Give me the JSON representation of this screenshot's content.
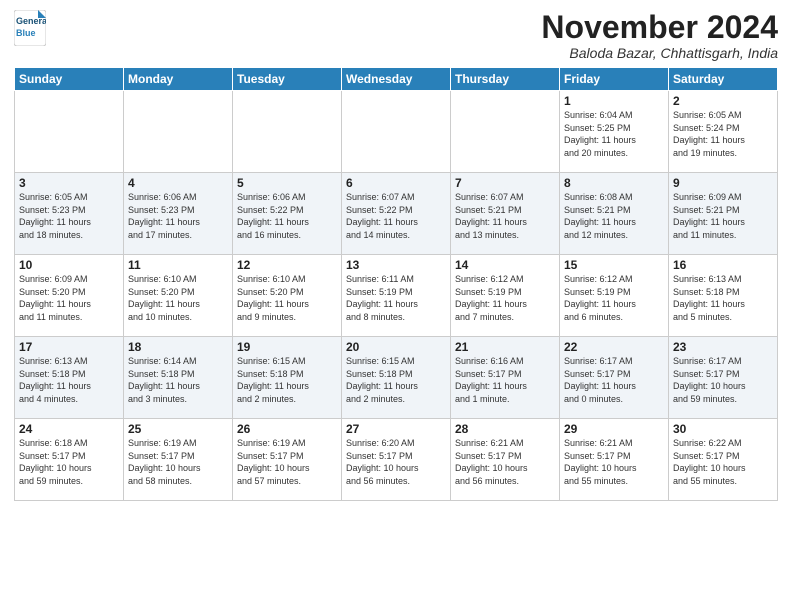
{
  "header": {
    "logo_line1": "General",
    "logo_line2": "Blue",
    "month": "November 2024",
    "location": "Baloda Bazar, Chhattisgarh, India"
  },
  "days_of_week": [
    "Sunday",
    "Monday",
    "Tuesday",
    "Wednesday",
    "Thursday",
    "Friday",
    "Saturday"
  ],
  "weeks": [
    [
      {
        "day": "",
        "info": ""
      },
      {
        "day": "",
        "info": ""
      },
      {
        "day": "",
        "info": ""
      },
      {
        "day": "",
        "info": ""
      },
      {
        "day": "",
        "info": ""
      },
      {
        "day": "1",
        "info": "Sunrise: 6:04 AM\nSunset: 5:25 PM\nDaylight: 11 hours\nand 20 minutes."
      },
      {
        "day": "2",
        "info": "Sunrise: 6:05 AM\nSunset: 5:24 PM\nDaylight: 11 hours\nand 19 minutes."
      }
    ],
    [
      {
        "day": "3",
        "info": "Sunrise: 6:05 AM\nSunset: 5:23 PM\nDaylight: 11 hours\nand 18 minutes."
      },
      {
        "day": "4",
        "info": "Sunrise: 6:06 AM\nSunset: 5:23 PM\nDaylight: 11 hours\nand 17 minutes."
      },
      {
        "day": "5",
        "info": "Sunrise: 6:06 AM\nSunset: 5:22 PM\nDaylight: 11 hours\nand 16 minutes."
      },
      {
        "day": "6",
        "info": "Sunrise: 6:07 AM\nSunset: 5:22 PM\nDaylight: 11 hours\nand 14 minutes."
      },
      {
        "day": "7",
        "info": "Sunrise: 6:07 AM\nSunset: 5:21 PM\nDaylight: 11 hours\nand 13 minutes."
      },
      {
        "day": "8",
        "info": "Sunrise: 6:08 AM\nSunset: 5:21 PM\nDaylight: 11 hours\nand 12 minutes."
      },
      {
        "day": "9",
        "info": "Sunrise: 6:09 AM\nSunset: 5:21 PM\nDaylight: 11 hours\nand 11 minutes."
      }
    ],
    [
      {
        "day": "10",
        "info": "Sunrise: 6:09 AM\nSunset: 5:20 PM\nDaylight: 11 hours\nand 11 minutes."
      },
      {
        "day": "11",
        "info": "Sunrise: 6:10 AM\nSunset: 5:20 PM\nDaylight: 11 hours\nand 10 minutes."
      },
      {
        "day": "12",
        "info": "Sunrise: 6:10 AM\nSunset: 5:20 PM\nDaylight: 11 hours\nand 9 minutes."
      },
      {
        "day": "13",
        "info": "Sunrise: 6:11 AM\nSunset: 5:19 PM\nDaylight: 11 hours\nand 8 minutes."
      },
      {
        "day": "14",
        "info": "Sunrise: 6:12 AM\nSunset: 5:19 PM\nDaylight: 11 hours\nand 7 minutes."
      },
      {
        "day": "15",
        "info": "Sunrise: 6:12 AM\nSunset: 5:19 PM\nDaylight: 11 hours\nand 6 minutes."
      },
      {
        "day": "16",
        "info": "Sunrise: 6:13 AM\nSunset: 5:18 PM\nDaylight: 11 hours\nand 5 minutes."
      }
    ],
    [
      {
        "day": "17",
        "info": "Sunrise: 6:13 AM\nSunset: 5:18 PM\nDaylight: 11 hours\nand 4 minutes."
      },
      {
        "day": "18",
        "info": "Sunrise: 6:14 AM\nSunset: 5:18 PM\nDaylight: 11 hours\nand 3 minutes."
      },
      {
        "day": "19",
        "info": "Sunrise: 6:15 AM\nSunset: 5:18 PM\nDaylight: 11 hours\nand 2 minutes."
      },
      {
        "day": "20",
        "info": "Sunrise: 6:15 AM\nSunset: 5:18 PM\nDaylight: 11 hours\nand 2 minutes."
      },
      {
        "day": "21",
        "info": "Sunrise: 6:16 AM\nSunset: 5:17 PM\nDaylight: 11 hours\nand 1 minute."
      },
      {
        "day": "22",
        "info": "Sunrise: 6:17 AM\nSunset: 5:17 PM\nDaylight: 11 hours\nand 0 minutes."
      },
      {
        "day": "23",
        "info": "Sunrise: 6:17 AM\nSunset: 5:17 PM\nDaylight: 10 hours\nand 59 minutes."
      }
    ],
    [
      {
        "day": "24",
        "info": "Sunrise: 6:18 AM\nSunset: 5:17 PM\nDaylight: 10 hours\nand 59 minutes."
      },
      {
        "day": "25",
        "info": "Sunrise: 6:19 AM\nSunset: 5:17 PM\nDaylight: 10 hours\nand 58 minutes."
      },
      {
        "day": "26",
        "info": "Sunrise: 6:19 AM\nSunset: 5:17 PM\nDaylight: 10 hours\nand 57 minutes."
      },
      {
        "day": "27",
        "info": "Sunrise: 6:20 AM\nSunset: 5:17 PM\nDaylight: 10 hours\nand 56 minutes."
      },
      {
        "day": "28",
        "info": "Sunrise: 6:21 AM\nSunset: 5:17 PM\nDaylight: 10 hours\nand 56 minutes."
      },
      {
        "day": "29",
        "info": "Sunrise: 6:21 AM\nSunset: 5:17 PM\nDaylight: 10 hours\nand 55 minutes."
      },
      {
        "day": "30",
        "info": "Sunrise: 6:22 AM\nSunset: 5:17 PM\nDaylight: 10 hours\nand 55 minutes."
      }
    ]
  ]
}
